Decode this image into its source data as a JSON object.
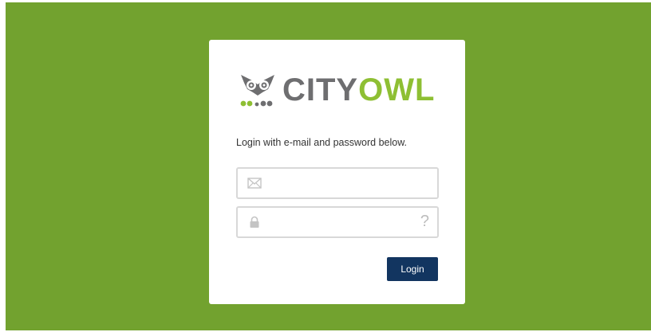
{
  "logo": {
    "word_part1": "CITY",
    "word_part2": "OWL",
    "icon": "owl-logo-icon"
  },
  "form": {
    "instructions": "Login with e-mail and password below.",
    "email": {
      "value": "",
      "placeholder": "",
      "icon": "envelope-icon"
    },
    "password": {
      "value": "",
      "placeholder": "",
      "icon": "lock-icon",
      "help_glyph": "?"
    },
    "submit_label": "Login"
  },
  "colors": {
    "background": "#72a22f",
    "card": "#ffffff",
    "brand_gray": "#6e6e70",
    "brand_green": "#8ebf33",
    "button": "#123560"
  }
}
